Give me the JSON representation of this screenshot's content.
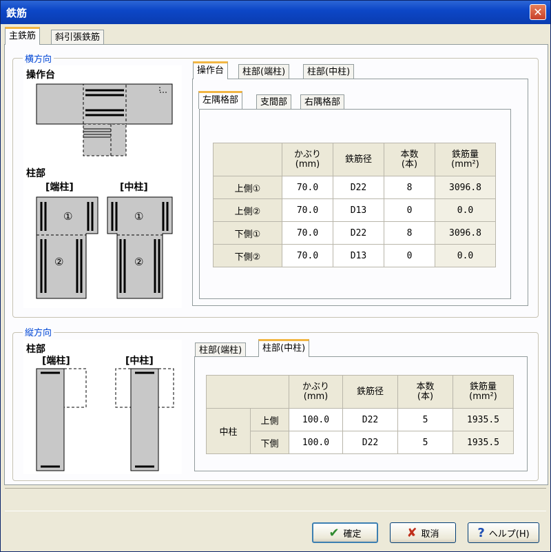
{
  "window": {
    "title": "鉄筋",
    "close_label": "✕"
  },
  "tabs_top": [
    "主鉄筋",
    "斜引張鉄筋"
  ],
  "horizontal": {
    "legend": "横方向",
    "diagram": {
      "label_top": "操作台",
      "label_col": "柱部",
      "label_end": "[端柱]",
      "label_mid": "[中柱]",
      "mark1": "①",
      "mark2": "②"
    },
    "tabs1": [
      "操作台",
      "柱部(端柱)",
      "柱部(中柱)"
    ],
    "tabs2": [
      "左隅格部",
      "支間部",
      "右隅格部"
    ],
    "table": {
      "headers": [
        "かぶり\n(mm)",
        "鉄筋径",
        "本数\n(本)",
        "鉄筋量\n(mm²)"
      ],
      "rows": [
        {
          "label": "上側①",
          "cover": "70.0",
          "dia": "D22",
          "count": "8",
          "area": "3096.8"
        },
        {
          "label": "上側②",
          "cover": "70.0",
          "dia": "D13",
          "count": "0",
          "area": "0.0"
        },
        {
          "label": "下側①",
          "cover": "70.0",
          "dia": "D22",
          "count": "8",
          "area": "3096.8"
        },
        {
          "label": "下側②",
          "cover": "70.0",
          "dia": "D13",
          "count": "0",
          "area": "0.0"
        }
      ]
    }
  },
  "vertical": {
    "legend": "縦方向",
    "diagram": {
      "label_col": "柱部",
      "label_end": "[端柱]",
      "label_mid": "[中柱]"
    },
    "tabs": [
      "柱部(端柱)",
      "柱部(中柱)"
    ],
    "table": {
      "headers": [
        "かぶり\n(mm)",
        "鉄筋径",
        "本数\n(本)",
        "鉄筋量\n(mm²)"
      ],
      "group_label": "中柱",
      "rows": [
        {
          "label": "上側",
          "cover": "100.0",
          "dia": "D22",
          "count": "5",
          "area": "1935.5"
        },
        {
          "label": "下側",
          "cover": "100.0",
          "dia": "D22",
          "count": "5",
          "area": "1935.5"
        }
      ]
    }
  },
  "buttons": {
    "ok": "確定",
    "cancel": "取消",
    "help": "ヘルプ(H)"
  }
}
